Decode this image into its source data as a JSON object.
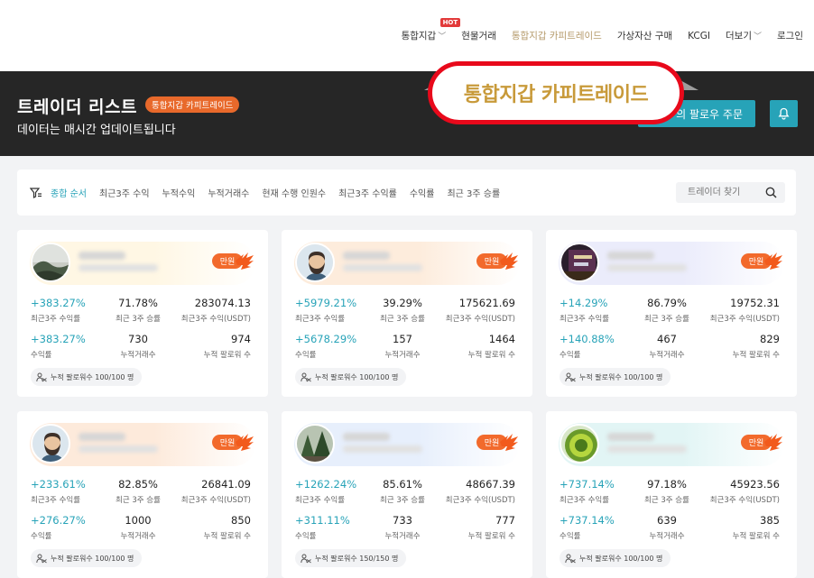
{
  "nav": {
    "items": [
      {
        "label": "통합지갑",
        "chevron": true,
        "hot": "HOT"
      },
      {
        "label": "현물거래"
      },
      {
        "label": "통합지갑 카피트레이드",
        "active": true
      },
      {
        "label": "가상자산 구매"
      },
      {
        "label": "KCGI"
      },
      {
        "label": "더보기",
        "chevron": true
      },
      {
        "label": "로그인"
      }
    ]
  },
  "callout": "통합지갑 카피트레이드",
  "banner": {
    "title": "트레이더 리스트",
    "tag": "통합지갑 카피트레이드",
    "subtitle": "데이터는 매시간 업데이트됩니다",
    "follow_button": "의 팔로우 주문"
  },
  "filters": {
    "items": [
      "종합 순서",
      "최근3주 수익",
      "누적수익",
      "누적거래수",
      "현재 수행 인원수",
      "최근3주 수익률",
      "수익률",
      "최근 3주 승률"
    ],
    "search_placeholder": "트레이더 찾기"
  },
  "labels": {
    "recent_return": "최근3주 수익률",
    "recent_winrate": "최근 3주 승률",
    "recent_profit": "최근3주 수익(USDT)",
    "return_rate": "수익률",
    "total_trades": "누적거래수",
    "total_followers": "누적 팔로워 수",
    "full_badge": "만원"
  },
  "colors": {
    "accent": "#27a3b8",
    "banner_bg": "#262626",
    "badge": "#f26a2c",
    "callout_border": "#e8091b"
  },
  "cards": [
    {
      "avatar": "landscape",
      "recent_return": "+383.27%",
      "recent_winrate": "71.78%",
      "recent_profit": "283074.13",
      "return_rate": "+383.27%",
      "total_trades": "730",
      "total_followers": "974",
      "follow_text": "누적 팔로워수 100/100 명",
      "tint": "#fff7e4"
    },
    {
      "avatar": "bearded-man",
      "recent_return": "+5979.21%",
      "recent_winrate": "39.29%",
      "recent_profit": "175621.69",
      "return_rate": "+5678.29%",
      "total_trades": "157",
      "total_followers": "1464",
      "follow_text": "누적 팔로워수 100/100 명",
      "tint": "#fdecdc"
    },
    {
      "avatar": "dark-photo",
      "recent_return": "+14.29%",
      "recent_winrate": "86.79%",
      "recent_profit": "19752.31",
      "return_rate": "+140.88%",
      "total_trades": "467",
      "total_followers": "829",
      "follow_text": "누적 팔로워수 100/100 명",
      "tint": "#ebecfb"
    },
    {
      "avatar": "bearded-man",
      "recent_return": "+233.61%",
      "recent_winrate": "82.85%",
      "recent_profit": "26841.09",
      "return_rate": "+276.27%",
      "total_trades": "1000",
      "total_followers": "850",
      "follow_text": "누적 팔로워수 100/100 명",
      "tint": "#fdeadb"
    },
    {
      "avatar": "forest",
      "recent_return": "+1262.24%",
      "recent_winrate": "85.61%",
      "recent_profit": "48667.39",
      "return_rate": "+311.11%",
      "total_trades": "733",
      "total_followers": "777",
      "follow_text": "누적 팔로워수 150/150 명",
      "tint": "#e7effc"
    },
    {
      "avatar": "green-coin",
      "recent_return": "+737.14%",
      "recent_winrate": "97.18%",
      "recent_profit": "45923.56",
      "return_rate": "+737.14%",
      "total_trades": "639",
      "total_followers": "385",
      "follow_text": "누적 팔로워수 100/100 명",
      "tint": "#e2f5f5"
    }
  ]
}
